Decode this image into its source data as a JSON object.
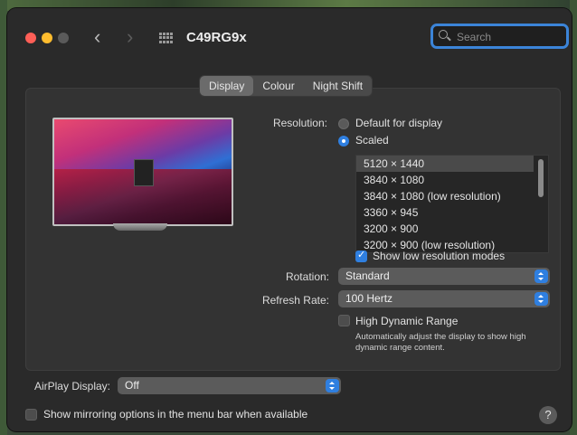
{
  "window": {
    "title": "C49RG9x"
  },
  "search": {
    "placeholder": "Search"
  },
  "tabs": [
    {
      "label": "Display",
      "active": true
    },
    {
      "label": "Colour",
      "active": false
    },
    {
      "label": "Night Shift",
      "active": false
    }
  ],
  "resolution": {
    "label": "Resolution:",
    "options": {
      "default": "Default for display",
      "scaled": "Scaled"
    },
    "selected_option": "Scaled",
    "list": [
      "5120 × 1440",
      "3840 × 1080",
      "3840 × 1080 (low resolution)",
      "3360 × 945",
      "3200 × 900",
      "3200 × 900 (low resolution)"
    ],
    "selected_index": 0
  },
  "show_low_res": {
    "label": "Show low resolution modes",
    "checked": true
  },
  "rotation": {
    "label": "Rotation:",
    "value": "Standard"
  },
  "refresh_rate": {
    "label": "Refresh Rate:",
    "value": "100 Hertz"
  },
  "hdr": {
    "label": "High Dynamic Range",
    "checked": false,
    "note": "Automatically adjust the display to show high dynamic range content."
  },
  "airplay": {
    "label": "AirPlay Display:",
    "value": "Off"
  },
  "mirroring": {
    "label": "Show mirroring options in the menu bar when available",
    "checked": false
  },
  "help": {
    "label": "?"
  },
  "colors": {
    "accent": "#2f7fe0",
    "window_bg": "#2a2a2a",
    "panel_bg": "#333333"
  }
}
